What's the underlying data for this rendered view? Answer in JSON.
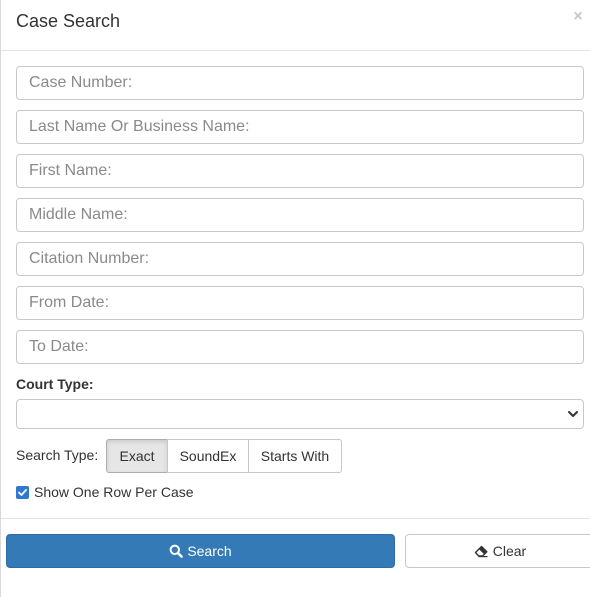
{
  "dialog": {
    "title": "Case Search",
    "close_glyph": "×"
  },
  "fields": {
    "case_number": {
      "placeholder": "Case Number:",
      "value": ""
    },
    "last_name": {
      "placeholder": "Last Name Or Business Name:",
      "value": ""
    },
    "first_name": {
      "placeholder": "First Name:",
      "value": ""
    },
    "middle_name": {
      "placeholder": "Middle Name:",
      "value": ""
    },
    "citation_number": {
      "placeholder": "Citation Number:",
      "value": ""
    },
    "from_date": {
      "placeholder": "From Date:",
      "value": ""
    },
    "to_date": {
      "placeholder": "To Date:",
      "value": ""
    }
  },
  "court_type": {
    "label": "Court Type:",
    "selected": ""
  },
  "search_type": {
    "label": "Search Type:",
    "options": [
      "Exact",
      "SoundEx",
      "Starts With"
    ],
    "selected": "Exact"
  },
  "one_row_per_case": {
    "label": "Show One Row Per Case",
    "checked": true
  },
  "footer": {
    "search_label": "Search",
    "clear_label": "Clear"
  },
  "colors": {
    "primary": "#337ab7",
    "checkbox": "#2f7ad0"
  },
  "icons": {
    "close": "close-icon",
    "dropdown": "chevron-down-icon",
    "search": "search-icon",
    "clear": "eraser-icon",
    "checkbox": "checkmark-icon"
  }
}
